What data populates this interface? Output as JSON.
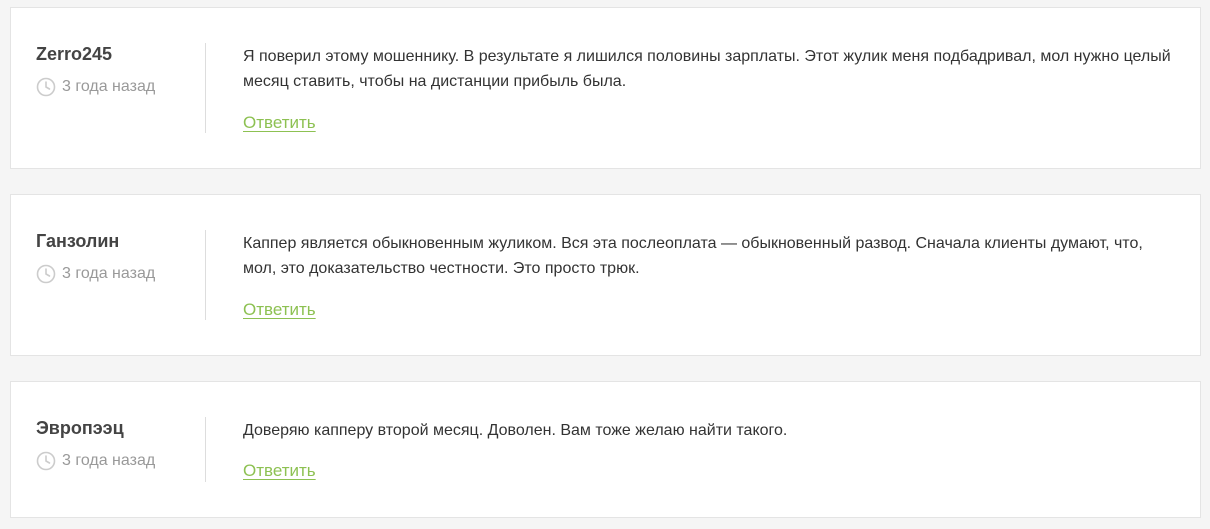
{
  "comments": [
    {
      "author": "Zerro245",
      "date": "3 года назад",
      "text": "Я поверил этому мошеннику. В результате я лишился половины зарплаты. Этот жулик меня подбадривал, мол нужно целый месяц ставить, чтобы на дистанции прибыль была.",
      "reply_label": "Ответить"
    },
    {
      "author": "Ганзолин",
      "date": "3 года назад",
      "text": "Каппер является обыкновенным жуликом. Вся эта послеоплата — обыкновенный развод. Сначала клиенты думают, что, мол, это доказательство честности. Это просто трюк.",
      "reply_label": "Ответить"
    },
    {
      "author": "Эвропээц",
      "date": "3 года назад",
      "text": "Доверяю капперу второй месяц. Доволен. Вам тоже желаю найти такого.",
      "reply_label": "Ответить"
    }
  ],
  "colors": {
    "accent": "#8dc152",
    "author": "#444444",
    "muted": "#999999",
    "background": "#f5f5f5",
    "card": "#ffffff"
  },
  "icons": {
    "date": "clock-icon"
  }
}
